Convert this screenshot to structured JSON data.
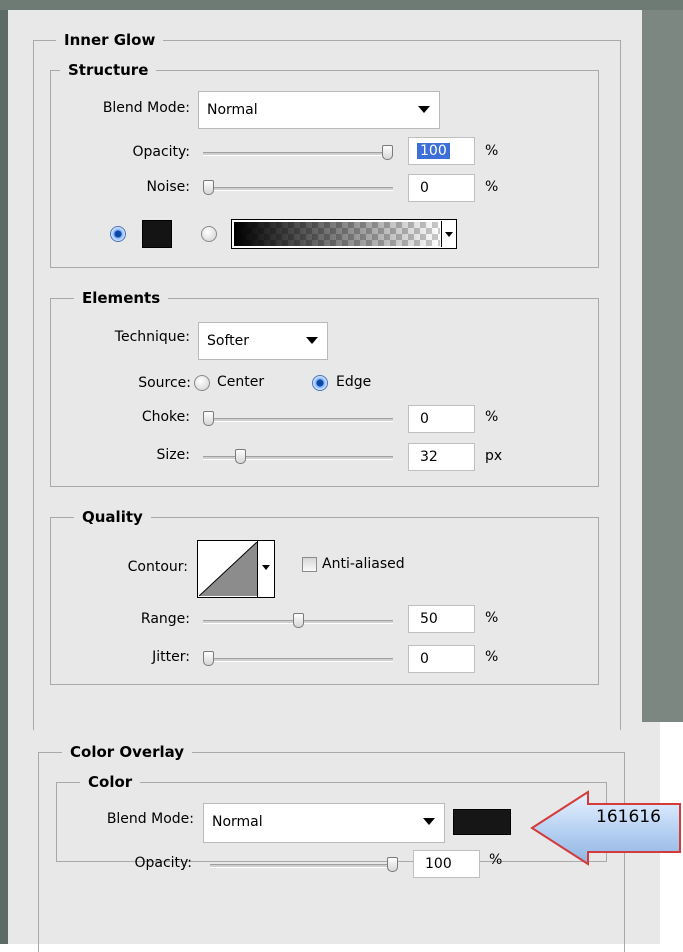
{
  "inner_glow": {
    "title": "Inner Glow",
    "structure": {
      "title": "Structure",
      "blend_mode_label": "Blend Mode:",
      "blend_mode_value": "Normal",
      "opacity_label": "Opacity:",
      "opacity_value": "100",
      "opacity_unit": "%",
      "opacity_level": 1.0,
      "noise_label": "Noise:",
      "noise_value": "0",
      "noise_unit": "%",
      "noise_level": 0.0,
      "color_mode": "solid",
      "solid_color": "#141414"
    },
    "elements": {
      "title": "Elements",
      "technique_label": "Technique:",
      "technique_value": "Softer",
      "source_label": "Source:",
      "source_center": "Center",
      "source_edge": "Edge",
      "source_selected": "Edge",
      "choke_label": "Choke:",
      "choke_value": "0",
      "choke_unit": "%",
      "choke_level": 0.0,
      "size_label": "Size:",
      "size_value": "32",
      "size_unit": "px",
      "size_level": 0.18
    },
    "quality": {
      "title": "Quality",
      "contour_label": "Contour:",
      "anti_aliased_label": "Anti-aliased",
      "anti_aliased_checked": false,
      "range_label": "Range:",
      "range_value": "50",
      "range_unit": "%",
      "range_level": 0.5,
      "jitter_label": "Jitter:",
      "jitter_value": "0",
      "jitter_unit": "%",
      "jitter_level": 0.0
    }
  },
  "color_overlay": {
    "title": "Color Overlay",
    "color_group_title": "Color",
    "blend_mode_label": "Blend Mode:",
    "blend_mode_value": "Normal",
    "swatch_color": "#161616",
    "opacity_label": "Opacity:",
    "opacity_value": "100",
    "opacity_unit": "%",
    "opacity_level": 1.0
  },
  "callout": {
    "text": "161616"
  }
}
